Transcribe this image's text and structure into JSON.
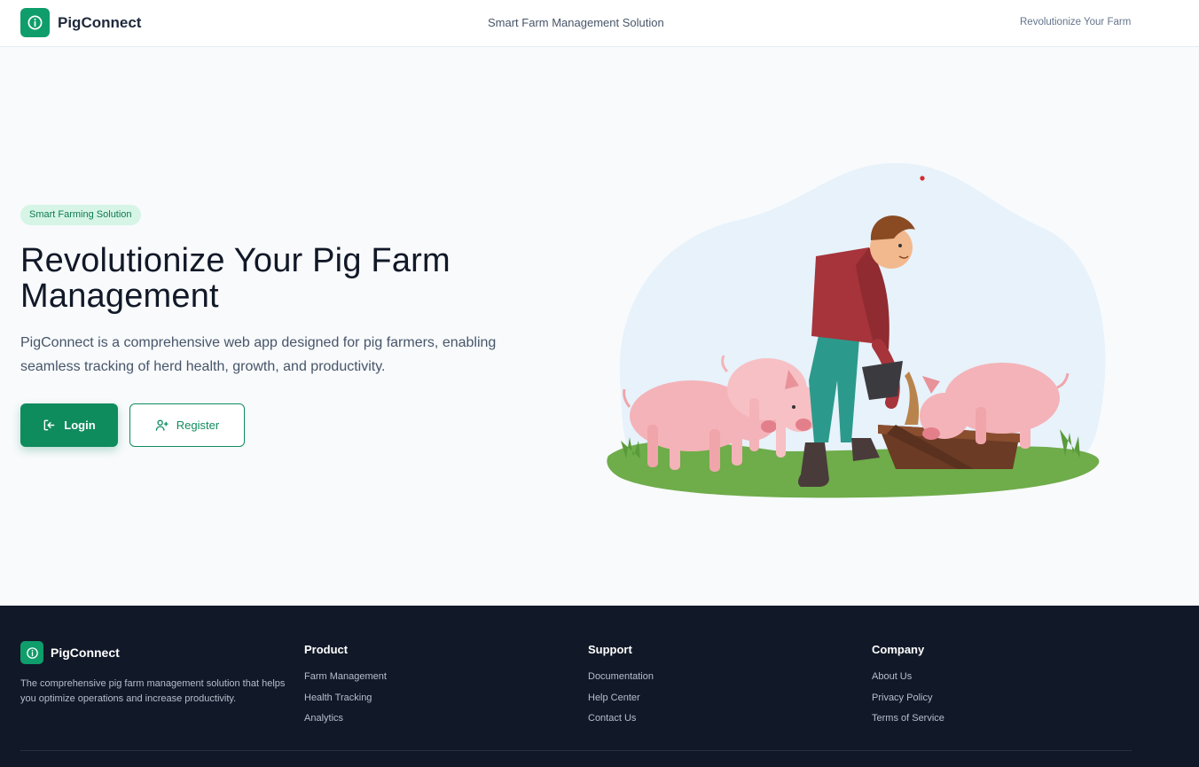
{
  "header": {
    "brand": "PigConnect",
    "center_text": "Smart Farm Management Solution",
    "right_text": "Revolutionize Your Farm"
  },
  "hero": {
    "badge": "Smart Farming Solution",
    "headline": "Revolutionize Your Pig Farm Management",
    "description": "PigConnect is a comprehensive web app designed for pig farmers, enabling seamless tracking of herd health, growth, and productivity.",
    "login_label": "Login",
    "register_label": "Register"
  },
  "footer": {
    "brand": "PigConnect",
    "description": "The comprehensive pig farm management solution that helps you optimize operations and increase productivity.",
    "columns": [
      {
        "title": "Product",
        "links": [
          "Farm Management",
          "Health Tracking",
          "Analytics"
        ]
      },
      {
        "title": "Support",
        "links": [
          "Documentation",
          "Help Center",
          "Contact Us"
        ]
      },
      {
        "title": "Company",
        "links": [
          "About Us",
          "Privacy Policy",
          "Terms of Service"
        ]
      }
    ]
  },
  "colors": {
    "accent": "#0f8c5e",
    "footer_bg": "#111827",
    "badge_bg": "#d6f5e6"
  }
}
